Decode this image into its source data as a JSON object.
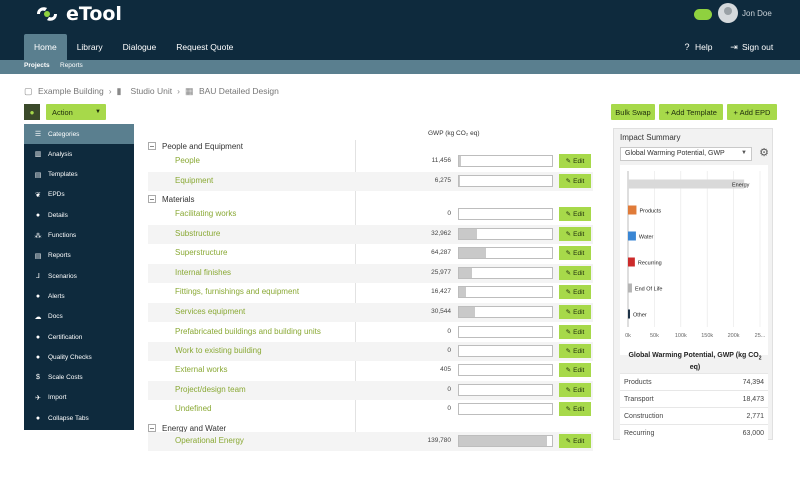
{
  "app": {
    "brand": "eTool",
    "user": "Jon Doe"
  },
  "nav": {
    "main": [
      "Home",
      "Library",
      "Dialogue",
      "Request Quote"
    ],
    "help": "Help",
    "signout": "Sign out",
    "sub": [
      "Projects",
      "Reports"
    ]
  },
  "breadcrumb": [
    "Example Building",
    "Studio Unit",
    "BAU Detailed Design"
  ],
  "toolbar": {
    "action": "Action",
    "bulk_swap": "Bulk Swap",
    "add_template": "+ Add Template",
    "add_epd": "+ Add EPD"
  },
  "sidebar": [
    {
      "label": "Categories",
      "icon": "list-icon"
    },
    {
      "label": "Analysis",
      "icon": "chart-icon"
    },
    {
      "label": "Templates",
      "icon": "templates-icon"
    },
    {
      "label": "EPDs",
      "icon": "leaf-icon"
    },
    {
      "label": "Details",
      "icon": "info-icon"
    },
    {
      "label": "Functions",
      "icon": "functions-icon"
    },
    {
      "label": "Reports",
      "icon": "document-icon"
    },
    {
      "label": "Scenarios",
      "icon": "scenarios-icon"
    },
    {
      "label": "Alerts",
      "icon": "alert-icon"
    },
    {
      "label": "Docs",
      "icon": "docs-icon"
    },
    {
      "label": "Certification",
      "icon": "certificate-icon"
    },
    {
      "label": "Quality Checks",
      "icon": "check-icon"
    },
    {
      "label": "Scale Costs",
      "icon": "dollar-icon"
    },
    {
      "label": "Import",
      "icon": "import-icon"
    },
    {
      "label": "Collapse Tabs",
      "icon": "collapse-icon"
    }
  ],
  "table": {
    "header": "GWP (kg CO₂ eq)",
    "edit_label": "Edit",
    "categories": [
      {
        "name": "People and Equipment"
      },
      {
        "name": "Materials"
      },
      {
        "name": "Energy and Water"
      }
    ],
    "rows": [
      {
        "label": "People",
        "value": "11,456",
        "fraction": 0.02
      },
      {
        "label": "Equipment",
        "value": "6,275",
        "fraction": 0.01
      },
      {
        "label": "Facilitating works",
        "value": "0",
        "fraction": 0
      },
      {
        "label": "Substructure",
        "value": "32,962",
        "fraction": 0.19
      },
      {
        "label": "Superstructure",
        "value": "64,287",
        "fraction": 0.29
      },
      {
        "label": "Internal finishes",
        "value": "25,977",
        "fraction": 0.14
      },
      {
        "label": "Fittings, furnishings and equipment",
        "value": "16,427",
        "fraction": 0.07
      },
      {
        "label": "Services equipment",
        "value": "30,544",
        "fraction": 0.17
      },
      {
        "label": "Prefabricated buildings and building units",
        "value": "0",
        "fraction": 0
      },
      {
        "label": "Work to existing building",
        "value": "0",
        "fraction": 0
      },
      {
        "label": "External works",
        "value": "405",
        "fraction": 0
      },
      {
        "label": "Project/design team",
        "value": "0",
        "fraction": 0
      },
      {
        "label": "Undefined",
        "value": "0",
        "fraction": 0
      },
      {
        "label": "Operational Energy",
        "value": "139,780",
        "fraction": 0.95
      }
    ]
  },
  "impact": {
    "title": "Impact Summary",
    "selected": "Global Warming Potential, GWP",
    "summary_title_1": "Global Warming Potential, GWP (kg CO",
    "summary_title_sub": "2",
    "summary_title_2": " eq)",
    "rows": [
      {
        "label": "Products",
        "value": "74,394"
      },
      {
        "label": "Transport",
        "value": "18,473"
      },
      {
        "label": "Construction",
        "value": "2,771"
      },
      {
        "label": "Recurring",
        "value": "63,000"
      }
    ]
  },
  "chart_data": {
    "type": "bar",
    "orientation": "horizontal",
    "categories": [
      "Energy",
      "Products",
      "Water",
      "Recurring",
      "End Of Life",
      "Other"
    ],
    "values": [
      220000,
      16000,
      15000,
      13000,
      7500,
      1500
    ],
    "colors": [
      "#d9d9d9",
      "#e07b39",
      "#3a86d4",
      "#cc2b2b",
      "#b5b5b5",
      "#1f3347"
    ],
    "xtick_labels": [
      "0k",
      "50k",
      "100k",
      "150k",
      "200k",
      "25..."
    ],
    "xlim": [
      0,
      250000
    ],
    "grid": true
  }
}
